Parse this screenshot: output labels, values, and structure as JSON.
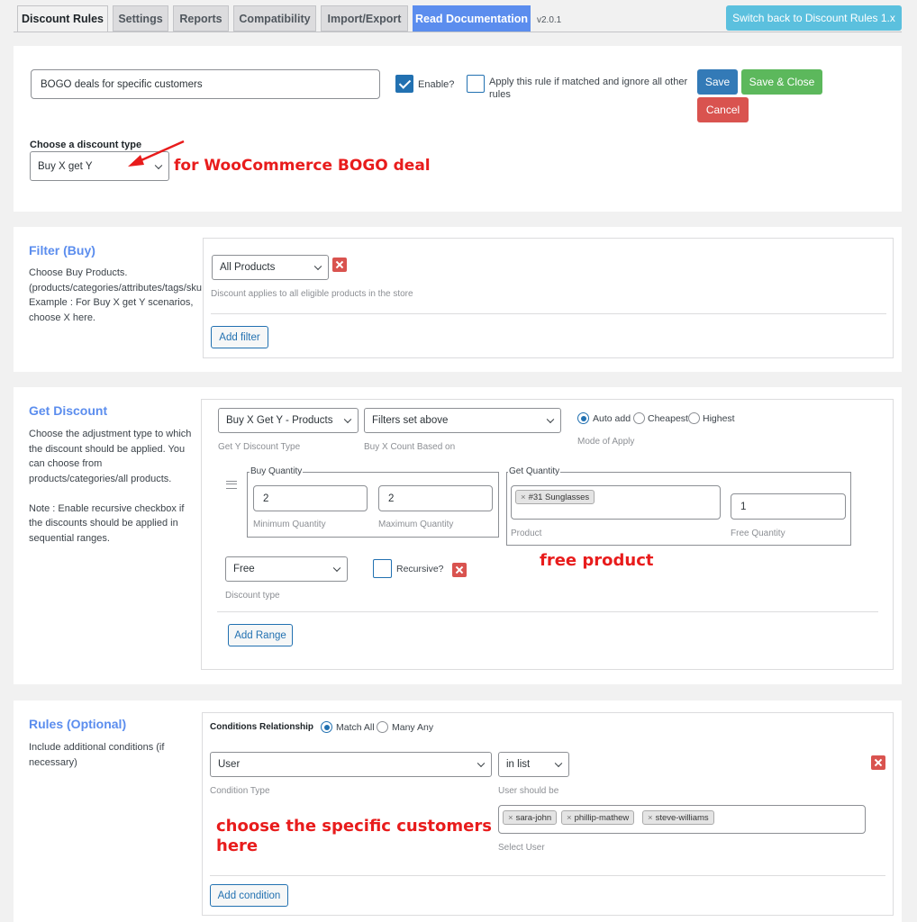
{
  "tabs": [
    {
      "label": "Discount Rules",
      "active": true
    },
    {
      "label": "Settings"
    },
    {
      "label": "Reports"
    },
    {
      "label": "Compatibility"
    },
    {
      "label": "Import/Export"
    },
    {
      "label": "Read Documentation"
    }
  ],
  "version": "v2.0.1",
  "switch_back_label": "Switch back to Discount Rules 1.x",
  "rule": {
    "name_value": "BOGO deals for specific customers",
    "enable_label": "Enable?",
    "enable_checked": true,
    "apply_exclusive_label": "Apply this rule if matched and ignore all other\nrules",
    "save_label": "Save",
    "save_close_label": "Save & Close",
    "cancel_label": "Cancel",
    "discount_type_label": "Choose a discount type",
    "discount_type_value": "Buy X get Y"
  },
  "filter": {
    "title": "Filter (Buy)",
    "description": "Choose Buy Products.\n(products/categories/attributes/tags/sku\nExample : For Buy X get Y scenarios,\nchoose X here.",
    "select_value": "All Products",
    "hint": "Discount applies to all eligible products in the store",
    "add_filter_label": "Add filter"
  },
  "get_discount": {
    "title": "Get Discount",
    "description": "Choose the adjustment type to which\nthe discount should be applied. You\ncan choose from\nproducts/categories/all products.\n\nNote : Enable recursive checkbox if\nthe discounts should be applied in\nsequential ranges.",
    "get_y_type_value": "Buy X Get Y - Products",
    "get_y_type_label": "Get Y Discount Type",
    "count_based_value": "Filters set above",
    "count_based_label": "Buy X Count Based on",
    "mode_options": [
      "Auto add",
      "Cheapest",
      "Highest"
    ],
    "mode_selected": "Auto add",
    "mode_label": "Mode of Apply",
    "buy_quantity_legend": "Buy Quantity",
    "min_qty_value": "2",
    "min_qty_label": "Minimum Quantity",
    "max_qty_value": "2",
    "max_qty_label": "Maximum Quantity",
    "get_quantity_legend": "Get Quantity",
    "product_tag": "#31 Sunglasses",
    "product_label": "Product",
    "free_qty_value": "1",
    "free_qty_label": "Free Quantity",
    "discount_type_value": "Free",
    "discount_type_label": "Discount type",
    "recursive_label": "Recursive?",
    "add_range_label": "Add Range"
  },
  "rules": {
    "title": "Rules (Optional)",
    "description": "Include additional conditions (if\nnecessary)",
    "relationship_label": "Conditions Relationship",
    "relationship_options": [
      "Match All",
      "Many Any"
    ],
    "relationship_selected": "Match All",
    "condition_type_value": "User",
    "condition_type_label": "Condition Type",
    "operator_value": "in list",
    "operator_label": "User should be",
    "users": [
      "sara-john",
      "phillip-mathew",
      "steve-williams"
    ],
    "select_user_label": "Select User",
    "add_condition_label": "Add condition"
  },
  "annotations": {
    "bogo": "for WooCommerce BOGO deal",
    "free_product": "free product",
    "customers": "choose the specific customers\nhere"
  },
  "colors": {
    "accent": "#5b8dee",
    "save": "#337ab7",
    "save_close": "#5cb85c",
    "cancel": "#d9534f",
    "annotation": "#e81c1c"
  }
}
